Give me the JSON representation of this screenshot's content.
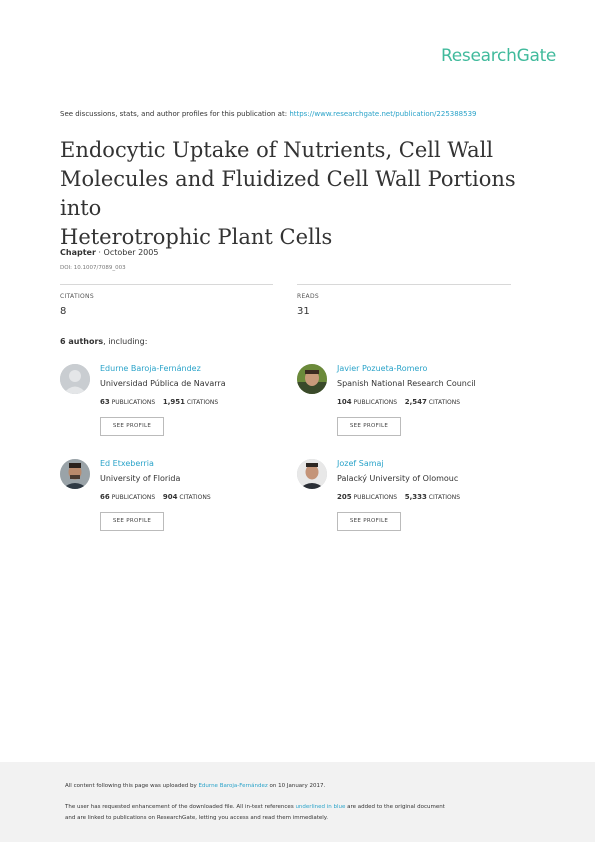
{
  "brand": {
    "logo_text": "ResearchGate",
    "accent": "#40ba9c",
    "link_color": "#2aa3c9"
  },
  "header": {
    "discuss_prefix": "See discussions, stats, and author profiles for this publication at: ",
    "discuss_url": "https://www.researchgate.net/publication/225388539"
  },
  "paper": {
    "title_lines": [
      "Endocytic Uptake of Nutrients, Cell Wall",
      "Molecules and Fluidized Cell Wall Portions into",
      "Heterotrophic Plant Cells"
    ],
    "type": "Chapter",
    "date": " · October 2005",
    "doi": "DOI: 10.1007/7089_003"
  },
  "stats": {
    "citations_label": "CITATIONS",
    "citations_value": "8",
    "reads_label": "READS",
    "reads_value": "31"
  },
  "authors_heading": {
    "count": "6 authors",
    "suffix": ", including:"
  },
  "authors": [
    {
      "name": "Edurne Baroja-Fernández",
      "institution": "Universidad Pública de Navarra",
      "publications": "63",
      "publications_label": "PUBLICATIONS",
      "citations": "1,951",
      "citations_label": "CITATIONS",
      "button": "SEE PROFILE",
      "avatar": "placeholder-avatar"
    },
    {
      "name": "Javier Pozueta-Romero",
      "institution": "Spanish National Research Council",
      "publications": "104",
      "publications_label": "PUBLICATIONS",
      "citations": "2,547",
      "citations_label": "CITATIONS",
      "button": "SEE PROFILE",
      "avatar": "photo-avatar"
    },
    {
      "name": "Ed Etxeberria",
      "institution": "University of Florida",
      "publications": "66",
      "publications_label": "PUBLICATIONS",
      "citations": "904",
      "citations_label": "CITATIONS",
      "button": "SEE PROFILE",
      "avatar": "photo-avatar"
    },
    {
      "name": "Jozef Samaj",
      "institution": "Palacký University of Olomouc",
      "publications": "205",
      "publications_label": "PUBLICATIONS",
      "citations": "5,333",
      "citations_label": "CITATIONS",
      "button": "SEE PROFILE",
      "avatar": "photo-avatar"
    }
  ],
  "footer": {
    "line1_prefix": "All content following this page was uploaded by ",
    "line1_uploader": "Edurne Baroja-Fernández",
    "line1_suffix": " on 10 January 2017.",
    "line2_prefix": "The user has requested enhancement of the downloaded file. All in-text references ",
    "line2_link": "underlined in blue",
    "line2_suffix": " are added to the original document",
    "line3": "and are linked to publications on ResearchGate, letting you access and read them immediately."
  }
}
